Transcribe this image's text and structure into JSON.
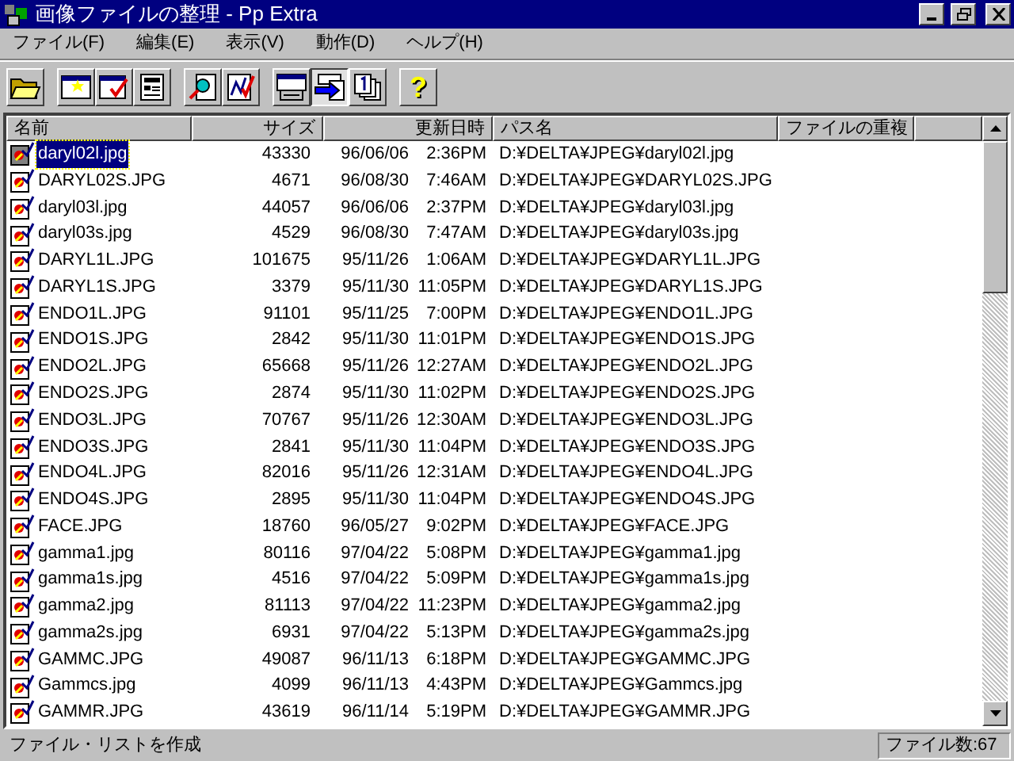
{
  "window": {
    "title": "画像ファイルの整理 - Pp Extra"
  },
  "menu": [
    {
      "label": "ファイル(F)"
    },
    {
      "label": "編集(E)"
    },
    {
      "label": "表示(V)"
    },
    {
      "label": "動作(D)"
    },
    {
      "label": "ヘルプ(H)"
    }
  ],
  "toolbar": [
    [
      {
        "kind": "open",
        "pressed": false
      }
    ],
    [
      {
        "kind": "new",
        "pressed": false
      },
      {
        "kind": "check",
        "pressed": false
      },
      {
        "kind": "form",
        "pressed": false
      }
    ],
    [
      {
        "kind": "search",
        "pressed": false
      },
      {
        "kind": "chart",
        "pressed": false
      }
    ],
    [
      {
        "kind": "printer",
        "pressed": false
      },
      {
        "kind": "send",
        "pressed": true
      },
      {
        "kind": "copy",
        "pressed": false
      }
    ],
    [
      {
        "kind": "help",
        "pressed": false,
        "label": "?"
      }
    ]
  ],
  "table": {
    "columns": [
      "名前",
      "サイズ",
      "更新日時",
      "パス名",
      "ファイルの重複"
    ],
    "rows": [
      {
        "name": "daryl02l.jpg",
        "size": "43330",
        "date": "96/06/06",
        "time": "2:36PM",
        "path": "D:¥DELTA¥JPEG¥daryl02l.jpg",
        "selected": true
      },
      {
        "name": "DARYL02S.JPG",
        "size": "4671",
        "date": "96/08/30",
        "time": "7:46AM",
        "path": "D:¥DELTA¥JPEG¥DARYL02S.JPG",
        "selected": false
      },
      {
        "name": "daryl03l.jpg",
        "size": "44057",
        "date": "96/06/06",
        "time": "2:37PM",
        "path": "D:¥DELTA¥JPEG¥daryl03l.jpg",
        "selected": false
      },
      {
        "name": "daryl03s.jpg",
        "size": "4529",
        "date": "96/08/30",
        "time": "7:47AM",
        "path": "D:¥DELTA¥JPEG¥daryl03s.jpg",
        "selected": false
      },
      {
        "name": "DARYL1L.JPG",
        "size": "101675",
        "date": "95/11/26",
        "time": "1:06AM",
        "path": "D:¥DELTA¥JPEG¥DARYL1L.JPG",
        "selected": false
      },
      {
        "name": "DARYL1S.JPG",
        "size": "3379",
        "date": "95/11/30",
        "time": "11:05PM",
        "path": "D:¥DELTA¥JPEG¥DARYL1S.JPG",
        "selected": false
      },
      {
        "name": "ENDO1L.JPG",
        "size": "91101",
        "date": "95/11/25",
        "time": "7:00PM",
        "path": "D:¥DELTA¥JPEG¥ENDO1L.JPG",
        "selected": false
      },
      {
        "name": "ENDO1S.JPG",
        "size": "2842",
        "date": "95/11/30",
        "time": "11:01PM",
        "path": "D:¥DELTA¥JPEG¥ENDO1S.JPG",
        "selected": false
      },
      {
        "name": "ENDO2L.JPG",
        "size": "65668",
        "date": "95/11/26",
        "time": "12:27AM",
        "path": "D:¥DELTA¥JPEG¥ENDO2L.JPG",
        "selected": false
      },
      {
        "name": "ENDO2S.JPG",
        "size": "2874",
        "date": "95/11/30",
        "time": "11:02PM",
        "path": "D:¥DELTA¥JPEG¥ENDO2S.JPG",
        "selected": false
      },
      {
        "name": "ENDO3L.JPG",
        "size": "70767",
        "date": "95/11/26",
        "time": "12:30AM",
        "path": "D:¥DELTA¥JPEG¥ENDO3L.JPG",
        "selected": false
      },
      {
        "name": "ENDO3S.JPG",
        "size": "2841",
        "date": "95/11/30",
        "time": "11:04PM",
        "path": "D:¥DELTA¥JPEG¥ENDO3S.JPG",
        "selected": false
      },
      {
        "name": "ENDO4L.JPG",
        "size": "82016",
        "date": "95/11/26",
        "time": "12:31AM",
        "path": "D:¥DELTA¥JPEG¥ENDO4L.JPG",
        "selected": false
      },
      {
        "name": "ENDO4S.JPG",
        "size": "2895",
        "date": "95/11/30",
        "time": "11:04PM",
        "path": "D:¥DELTA¥JPEG¥ENDO4S.JPG",
        "selected": false
      },
      {
        "name": "FACE.JPG",
        "size": "18760",
        "date": "96/05/27",
        "time": "9:02PM",
        "path": "D:¥DELTA¥JPEG¥FACE.JPG",
        "selected": false
      },
      {
        "name": "gamma1.jpg",
        "size": "80116",
        "date": "97/04/22",
        "time": "5:08PM",
        "path": "D:¥DELTA¥JPEG¥gamma1.jpg",
        "selected": false
      },
      {
        "name": "gamma1s.jpg",
        "size": "4516",
        "date": "97/04/22",
        "time": "5:09PM",
        "path": "D:¥DELTA¥JPEG¥gamma1s.jpg",
        "selected": false
      },
      {
        "name": "gamma2.jpg",
        "size": "81113",
        "date": "97/04/22",
        "time": "11:23PM",
        "path": "D:¥DELTA¥JPEG¥gamma2.jpg",
        "selected": false
      },
      {
        "name": "gamma2s.jpg",
        "size": "6931",
        "date": "97/04/22",
        "time": "5:13PM",
        "path": "D:¥DELTA¥JPEG¥gamma2s.jpg",
        "selected": false
      },
      {
        "name": "GAMMC.JPG",
        "size": "49087",
        "date": "96/11/13",
        "time": "6:18PM",
        "path": "D:¥DELTA¥JPEG¥GAMMC.JPG",
        "selected": false
      },
      {
        "name": "Gammcs.jpg",
        "size": "4099",
        "date": "96/11/13",
        "time": "4:43PM",
        "path": "D:¥DELTA¥JPEG¥Gammcs.jpg",
        "selected": false
      },
      {
        "name": "GAMMR.JPG",
        "size": "43619",
        "date": "96/11/14",
        "time": "5:19PM",
        "path": "D:¥DELTA¥JPEG¥GAMMR.JPG",
        "selected": false
      }
    ]
  },
  "status_bar": {
    "message": "ファイル・リストを作成",
    "count": "ファイル数:67"
  }
}
